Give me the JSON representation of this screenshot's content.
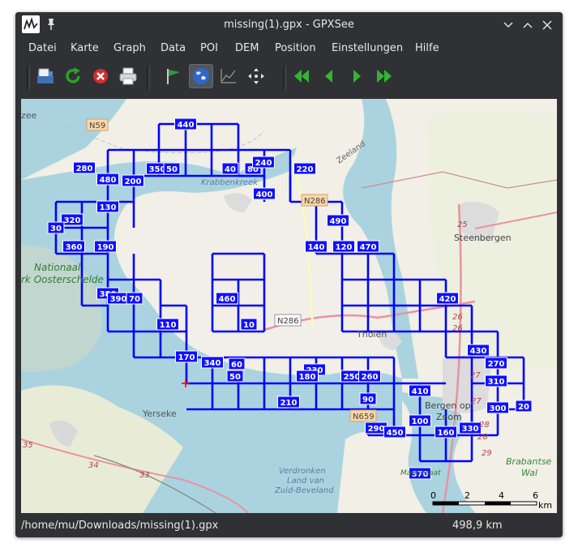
{
  "window": {
    "title": "missing(1).gpx - GPXSee"
  },
  "menu": [
    "Datei",
    "Karte",
    "Graph",
    "Data",
    "POI",
    "DEM",
    "Position",
    "Einstellungen",
    "Hilfe"
  ],
  "toolbar": {
    "open": "open-file-icon",
    "reload": "reload-icon",
    "close": "close-file-icon",
    "print": "print-icon",
    "waypoints": "flag-icon",
    "map": "globe-icon",
    "graph": "graph-icon",
    "fullscreen": "move-icon",
    "first": "first-icon",
    "prev": "prev-icon",
    "next": "next-icon",
    "last": "last-icon"
  },
  "map": {
    "place_labels": [
      "zee",
      "Yerseke",
      "Tholen",
      "Bergen op",
      "Zoom",
      "Steenbergen",
      "Brabantse",
      "Wal",
      "Verdronken",
      "Land van",
      "Zuid-Beveland",
      "Zeeland",
      "Krabbenkreek",
      "Nationaal",
      "rk Oosterschelde"
    ],
    "road_labels": [
      "N59",
      "N286",
      "N286",
      "N659",
      "25",
      "26",
      "26",
      "27",
      "27",
      "28",
      "28",
      "29",
      "34",
      "33",
      "35",
      "Markiezaat"
    ],
    "markers": [
      "440",
      "280",
      "480",
      "200",
      "350",
      "50",
      "40",
      "80",
      "240",
      "220",
      "400",
      "130",
      "320",
      "30",
      "360",
      "190",
      "490",
      "140",
      "120",
      "470",
      "380",
      "390",
      "70",
      "420",
      "460",
      "10",
      "110",
      "430",
      "170",
      "340",
      "60",
      "50",
      "230",
      "250",
      "260",
      "270",
      "310",
      "180",
      "210",
      "410",
      "90",
      "300",
      "20",
      "100",
      "290",
      "450",
      "160",
      "330",
      "370"
    ],
    "scale": {
      "ticks": [
        "0",
        "2",
        "4",
        "6"
      ],
      "unit": "km"
    }
  },
  "status": {
    "path": "/home/mu/Downloads/missing(1).gpx",
    "distance": "498,9 km"
  },
  "colors": {
    "track": "#0000ff",
    "water": "#aad3df",
    "land": "#f2efe9",
    "window": "#2f3134"
  }
}
